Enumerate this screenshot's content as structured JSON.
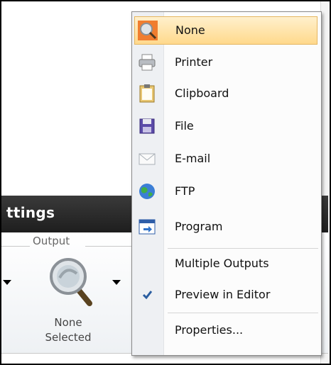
{
  "ribbon": {
    "title": "ttings",
    "group_label": "Output",
    "none_selected_line1": "None",
    "none_selected_line2": "Selected"
  },
  "menu": {
    "items": [
      {
        "label": "None",
        "icon": "magnifier-icon",
        "highlighted": true
      },
      {
        "label": "Printer",
        "icon": "printer-icon"
      },
      {
        "label": "Clipboard",
        "icon": "clipboard-icon"
      },
      {
        "label": "File",
        "icon": "floppy-disk-icon"
      },
      {
        "label": "E-mail",
        "icon": "envelope-icon"
      },
      {
        "label": "FTP",
        "icon": "globe-icon"
      },
      {
        "label": "Program",
        "icon": "program-window-icon"
      },
      {
        "label": "Multiple Outputs"
      },
      {
        "label": "Preview in Editor",
        "checked": true
      },
      {
        "label": "Properties..."
      }
    ]
  }
}
